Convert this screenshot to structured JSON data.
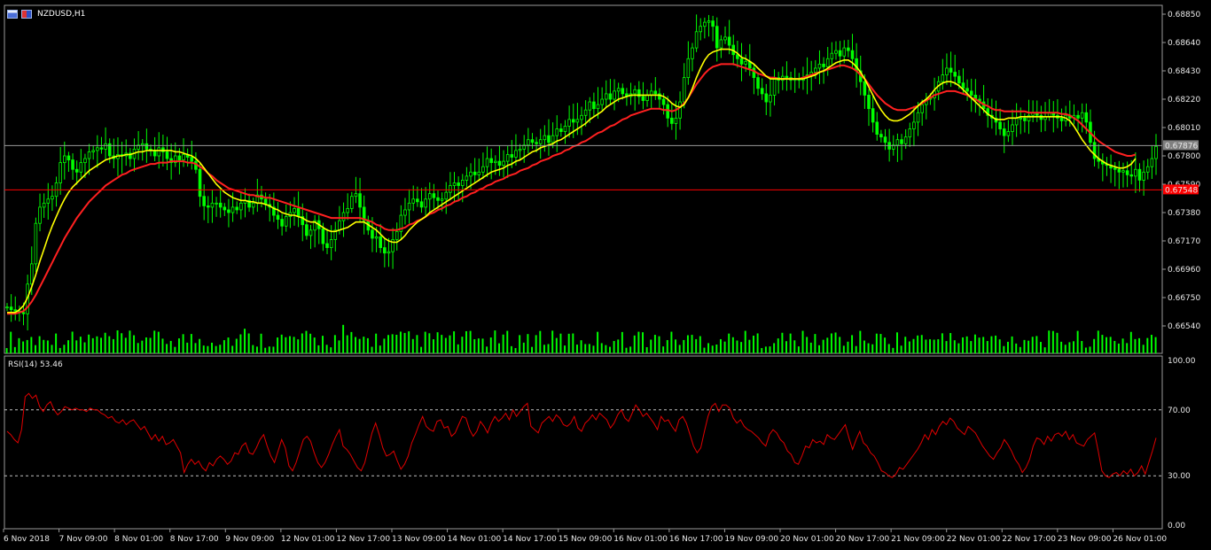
{
  "title": {
    "symbol": "NZDUSD,H1"
  },
  "colors": {
    "background": "#000000",
    "candle": "#00ff00",
    "ma_fast": "#ffff00",
    "ma_slow": "#ff2020",
    "rsi": "#e00000",
    "bid_line": "#9a9a9a",
    "ask_line": "#ff0000",
    "grid_text": "#e8e8e8"
  },
  "price_axis": {
    "ticks": [
      "0.68850",
      "0.68640",
      "0.68430",
      "0.68220",
      "0.68010",
      "0.67800",
      "0.67590",
      "0.67380",
      "0.67170",
      "0.66960",
      "0.66750",
      "0.66540"
    ],
    "current_bid": "0.67876",
    "ask_label": "0.67548"
  },
  "rsi_panel": {
    "label": "RSI(14) 53.46",
    "ticks": [
      "100.00",
      "70.00",
      "30.00",
      "0.00"
    ],
    "levels": [
      70,
      30
    ],
    "values": [
      57,
      55,
      52,
      50,
      58,
      78,
      80,
      77,
      79,
      72,
      69,
      73,
      75,
      70,
      67,
      69,
      72,
      71,
      70,
      71,
      70,
      70,
      69,
      71,
      70,
      70,
      68,
      67,
      65,
      66,
      63,
      62,
      64,
      61,
      63,
      64,
      61,
      58,
      60,
      56,
      52,
      55,
      51,
      54,
      49,
      50,
      52,
      48,
      44,
      32,
      37,
      40,
      37,
      39,
      35,
      33,
      38,
      36,
      40,
      42,
      40,
      37,
      39,
      44,
      43,
      48,
      50,
      44,
      43,
      47,
      52,
      55,
      48,
      42,
      38,
      45,
      52,
      47,
      36,
      33,
      38,
      45,
      52,
      54,
      51,
      44,
      38,
      35,
      38,
      43,
      49,
      54,
      58,
      48,
      46,
      43,
      39,
      35,
      33,
      38,
      47,
      56,
      62,
      55,
      47,
      42,
      43,
      45,
      39,
      34,
      37,
      42,
      50,
      55,
      61,
      66,
      60,
      58,
      57,
      63,
      64,
      59,
      60,
      54,
      56,
      61,
      66,
      65,
      58,
      54,
      57,
      63,
      60,
      56,
      62,
      66,
      63,
      65,
      68,
      64,
      70,
      66,
      69,
      72,
      74,
      60,
      58,
      56,
      62,
      64,
      66,
      63,
      67,
      65,
      61,
      60,
      62,
      66,
      59,
      57,
      62,
      64,
      67,
      64,
      68,
      66,
      64,
      59,
      62,
      67,
      70,
      65,
      63,
      68,
      73,
      70,
      66,
      68,
      65,
      62,
      58,
      66,
      63,
      64,
      60,
      57,
      64,
      66,
      62,
      55,
      48,
      44,
      47,
      57,
      66,
      72,
      74,
      69,
      73,
      73,
      71,
      65,
      62,
      64,
      60,
      58,
      57,
      55,
      53,
      50,
      48,
      55,
      58,
      56,
      52,
      50,
      45,
      43,
      38,
      37,
      42,
      48,
      47,
      52,
      50,
      51,
      49,
      55,
      53,
      52,
      55,
      58,
      61,
      53,
      46,
      52,
      57,
      50,
      48,
      44,
      42,
      38,
      33,
      32,
      30,
      29,
      31,
      35,
      34,
      37,
      40,
      43,
      46,
      50,
      55,
      52,
      58,
      55,
      60,
      63,
      61,
      65,
      63,
      59,
      57,
      55,
      60,
      58,
      56,
      52,
      48,
      45,
      42,
      40,
      44,
      47,
      52,
      49,
      45,
      40,
      37,
      32,
      35,
      40,
      48,
      53,
      52,
      49,
      54,
      51,
      55,
      56,
      54,
      57,
      52,
      55,
      50,
      49,
      48,
      52,
      54,
      56,
      45,
      33,
      30,
      29,
      31,
      32,
      30,
      33,
      31,
      34,
      30,
      32,
      36,
      31,
      38,
      45,
      53
    ],
    "rsi_range": [
      0,
      100
    ]
  },
  "time_axis": {
    "labels": [
      "6 Nov 2018",
      "7 Nov 09:00",
      "8 Nov 01:00",
      "8 Nov 17:00",
      "9 Nov 09:00",
      "12 Nov 01:00",
      "12 Nov 17:00",
      "13 Nov 09:00",
      "14 Nov 01:00",
      "14 Nov 17:00",
      "15 Nov 09:00",
      "16 Nov 01:00",
      "16 Nov 17:00",
      "19 Nov 09:00",
      "20 Nov 01:00",
      "20 Nov 17:00",
      "21 Nov 09:00",
      "22 Nov 01:00",
      "22 Nov 17:00",
      "23 Nov 09:00",
      "26 Nov 01:00"
    ]
  },
  "chart_data": {
    "type": "line",
    "title": "NZDUSD,H1",
    "price_range": [
      0.6642,
      0.6893
    ],
    "series": [
      {
        "name": "",
        "role": "close",
        "values": [
          0.6668,
          0.6666,
          0.6665,
          0.6664,
          0.6663,
          0.6685,
          0.67,
          0.673,
          0.6742,
          0.6745,
          0.6748,
          0.675,
          0.676,
          0.6775,
          0.678,
          0.6777,
          0.677,
          0.6768,
          0.6775,
          0.6778,
          0.6783,
          0.6784,
          0.6786,
          0.6785,
          0.6789,
          0.678,
          0.6778,
          0.6781,
          0.678,
          0.6782,
          0.6778,
          0.6785,
          0.6788,
          0.6789,
          0.6785,
          0.6784,
          0.678,
          0.6786,
          0.6783,
          0.6778,
          0.6775,
          0.678,
          0.6777,
          0.6781,
          0.6779,
          0.6776,
          0.677,
          0.675,
          0.6743,
          0.6742,
          0.6745,
          0.6745,
          0.6742,
          0.674,
          0.6738,
          0.6742,
          0.674,
          0.6745,
          0.6747,
          0.6742,
          0.6745,
          0.6751,
          0.6748,
          0.6744,
          0.6742,
          0.6736,
          0.6733,
          0.6728,
          0.6735,
          0.6738,
          0.6741,
          0.6735,
          0.6729,
          0.6721,
          0.6725,
          0.6732,
          0.6726,
          0.6715,
          0.6712,
          0.6718,
          0.6725,
          0.6732,
          0.6738,
          0.6741,
          0.675,
          0.6752,
          0.6742,
          0.6732,
          0.6725,
          0.6719,
          0.672,
          0.6712,
          0.6708,
          0.6709,
          0.6718,
          0.6724,
          0.6736,
          0.674,
          0.6745,
          0.6748,
          0.6746,
          0.6742,
          0.6748,
          0.6752,
          0.6749,
          0.6747,
          0.6748,
          0.6753,
          0.6758,
          0.676,
          0.6758,
          0.6762,
          0.6765,
          0.6768,
          0.6766,
          0.6768,
          0.6772,
          0.6778,
          0.6775,
          0.6776,
          0.6773,
          0.6776,
          0.6781,
          0.6779,
          0.6784,
          0.6785,
          0.6788,
          0.6792,
          0.679,
          0.6789,
          0.6792,
          0.6795,
          0.679,
          0.6795,
          0.68,
          0.6798,
          0.6802,
          0.6807,
          0.6805,
          0.6807,
          0.681,
          0.6814,
          0.682,
          0.6815,
          0.6818,
          0.6822,
          0.6826,
          0.6822,
          0.6828,
          0.683,
          0.6826,
          0.6824,
          0.6826,
          0.6829,
          0.6824,
          0.6821,
          0.6825,
          0.6828,
          0.6826,
          0.6822,
          0.6818,
          0.6808,
          0.6804,
          0.6808,
          0.682,
          0.6838,
          0.6852,
          0.686,
          0.6872,
          0.6876,
          0.6879,
          0.688,
          0.6876,
          0.686,
          0.6866,
          0.6868,
          0.6862,
          0.6855,
          0.6852,
          0.6848,
          0.685,
          0.6845,
          0.6838,
          0.683,
          0.6826,
          0.682,
          0.6825,
          0.6838,
          0.6836,
          0.6839,
          0.6838,
          0.6836,
          0.6837,
          0.6836,
          0.6838,
          0.684,
          0.6842,
          0.6845,
          0.6848,
          0.6846,
          0.6852,
          0.6856,
          0.6858,
          0.6854,
          0.686,
          0.6858,
          0.6852,
          0.6843,
          0.6835,
          0.6825,
          0.6815,
          0.6805,
          0.6796,
          0.6794,
          0.679,
          0.6785,
          0.6788,
          0.6792,
          0.6789,
          0.6794,
          0.68,
          0.6805,
          0.6812,
          0.6818,
          0.6822,
          0.6823,
          0.6828,
          0.6835,
          0.684,
          0.6845,
          0.6842,
          0.6839,
          0.6834,
          0.683,
          0.6828,
          0.6825,
          0.6822,
          0.682,
          0.6815,
          0.681,
          0.6808,
          0.6805,
          0.68,
          0.6795,
          0.6798,
          0.6803,
          0.6808,
          0.6808,
          0.6806,
          0.681,
          0.6812,
          0.681,
          0.6807,
          0.6809,
          0.6812,
          0.681,
          0.6808,
          0.6806,
          0.681,
          0.6808,
          0.681,
          0.6808,
          0.6812,
          0.6805,
          0.679,
          0.6778,
          0.6776,
          0.6774,
          0.6773,
          0.6771,
          0.677,
          0.6768,
          0.6769,
          0.6766,
          0.6765,
          0.677,
          0.6762,
          0.6768,
          0.6772,
          0.6778,
          0.6787
        ]
      },
      {
        "name": "",
        "role": "ma_fast",
        "values": [
          0.6664,
          0.6664,
          0.6664,
          0.6666,
          0.6669,
          0.6675,
          0.6683,
          0.6692,
          0.6702,
          0.6711,
          0.672,
          0.6728,
          0.6735,
          0.6742,
          0.6748,
          0.6753,
          0.6757,
          0.676,
          0.6763,
          0.6766,
          0.6769,
          0.6771,
          0.6773,
          0.6775,
          0.6777,
          0.6778,
          0.6779,
          0.678,
          0.678,
          0.6781,
          0.6781,
          0.6782,
          0.6783,
          0.6783,
          0.6784,
          0.6784,
          0.6784,
          0.6784,
          0.6784,
          0.6784,
          0.6784,
          0.6783,
          0.6783,
          0.6782,
          0.6781,
          0.678,
          0.6778,
          0.6775,
          0.6771,
          0.6767,
          0.6763,
          0.6759,
          0.6756,
          0.6753,
          0.6751,
          0.6749,
          0.6748,
          0.6747,
          0.6747,
          0.6746,
          0.6746,
          0.6745,
          0.6745,
          0.6744,
          0.6743,
          0.6741,
          0.674,
          0.6738,
          0.6737,
          0.6736,
          0.6736,
          0.6735,
          0.6734,
          0.6732,
          0.6731,
          0.6731,
          0.6729,
          0.6727,
          0.6725,
          0.6724,
          0.6724,
          0.6725,
          0.6726,
          0.6727,
          0.6729,
          0.6731,
          0.6731,
          0.6731,
          0.6729,
          0.6727,
          0.6725,
          0.6722,
          0.6719,
          0.6717,
          0.6716,
          0.6716,
          0.6718,
          0.6721,
          0.6725,
          0.6728,
          0.6731,
          0.6733,
          0.6735,
          0.6738,
          0.674,
          0.6742,
          0.6744,
          0.6746,
          0.6748,
          0.675,
          0.6752,
          0.6754,
          0.6756,
          0.6758,
          0.676,
          0.6762,
          0.6764,
          0.6766,
          0.6768,
          0.6769,
          0.677,
          0.6771,
          0.6773,
          0.6774,
          0.6776,
          0.6777,
          0.6779,
          0.6781,
          0.6783,
          0.6784,
          0.6786,
          0.6787,
          0.6788,
          0.6789,
          0.6791,
          0.6792,
          0.6794,
          0.6796,
          0.6798,
          0.68,
          0.6802,
          0.6804,
          0.6807,
          0.6809,
          0.6811,
          0.6813,
          0.6816,
          0.6818,
          0.682,
          0.6822,
          0.6823,
          0.6824,
          0.6825,
          0.6825,
          0.6825,
          0.6825,
          0.6825,
          0.6825,
          0.6825,
          0.6825,
          0.6824,
          0.6822,
          0.6819,
          0.6817,
          0.6816,
          0.6818,
          0.6823,
          0.683,
          0.6838,
          0.6845,
          0.6851,
          0.6855,
          0.6857,
          0.6858,
          0.6859,
          0.6859,
          0.6859,
          0.6858,
          0.6856,
          0.6853,
          0.6852,
          0.685,
          0.6848,
          0.6845,
          0.6842,
          0.6839,
          0.6837,
          0.6837,
          0.6837,
          0.6837,
          0.6837,
          0.6837,
          0.6837,
          0.6837,
          0.6837,
          0.6838,
          0.6839,
          0.684,
          0.6842,
          0.6843,
          0.6845,
          0.6847,
          0.6849,
          0.685,
          0.6851,
          0.6851,
          0.6849,
          0.6846,
          0.6842,
          0.6837,
          0.6831,
          0.6825,
          0.6819,
          0.6814,
          0.681,
          0.6807,
          0.6806,
          0.6806,
          0.6807,
          0.6809,
          0.6811,
          0.6814,
          0.6817,
          0.682,
          0.6822,
          0.6825,
          0.6829,
          0.6832,
          0.6834,
          0.6835,
          0.6835,
          0.6834,
          0.6832,
          0.6829,
          0.6826,
          0.6823,
          0.682,
          0.6817,
          0.6814,
          0.6811,
          0.6809,
          0.6807,
          0.6807,
          0.6807,
          0.6808,
          0.6808,
          0.6808,
          0.6809,
          0.6809,
          0.6809,
          0.6809,
          0.6809,
          0.6809,
          0.6809,
          0.6809,
          0.6809,
          0.6809,
          0.6809,
          0.6808,
          0.6806,
          0.6802,
          0.6797,
          0.6792,
          0.6788,
          0.6784,
          0.6781,
          0.6778,
          0.6776,
          0.6774,
          0.6773,
          0.6772,
          0.6771,
          0.6771,
          0.6772,
          0.6774,
          0.6778
        ]
      },
      {
        "name": "",
        "role": "ma_slow",
        "values": [
          0.6663,
          0.6663,
          0.6663,
          0.6664,
          0.6665,
          0.6668,
          0.6672,
          0.6677,
          0.6683,
          0.6689,
          0.6695,
          0.6701,
          0.6707,
          0.6713,
          0.6719,
          0.6724,
          0.6729,
          0.6734,
          0.6738,
          0.6742,
          0.6746,
          0.6749,
          0.6752,
          0.6755,
          0.6758,
          0.676,
          0.6762,
          0.6764,
          0.6766,
          0.6767,
          0.6769,
          0.677,
          0.6771,
          0.6772,
          0.6773,
          0.6774,
          0.6774,
          0.6775,
          0.6775,
          0.6775,
          0.6776,
          0.6776,
          0.6776,
          0.6776,
          0.6775,
          0.6775,
          0.6774,
          0.6772,
          0.677,
          0.6767,
          0.6765,
          0.6762,
          0.676,
          0.6758,
          0.6756,
          0.6755,
          0.6754,
          0.6753,
          0.6752,
          0.6751,
          0.6751,
          0.675,
          0.675,
          0.6749,
          0.6749,
          0.6748,
          0.6747,
          0.6746,
          0.6745,
          0.6744,
          0.6743,
          0.6742,
          0.6741,
          0.674,
          0.6739,
          0.6738,
          0.6737,
          0.6736,
          0.6735,
          0.6734,
          0.6734,
          0.6734,
          0.6734,
          0.6734,
          0.6734,
          0.6734,
          0.6734,
          0.6733,
          0.6732,
          0.6731,
          0.6729,
          0.6728,
          0.6726,
          0.6725,
          0.6725,
          0.6725,
          0.6726,
          0.6727,
          0.6729,
          0.673,
          0.6732,
          0.6733,
          0.6735,
          0.6737,
          0.6738,
          0.674,
          0.6741,
          0.6743,
          0.6744,
          0.6746,
          0.6747,
          0.6749,
          0.675,
          0.6752,
          0.6753,
          0.6755,
          0.6756,
          0.6758,
          0.6759,
          0.6761,
          0.6762,
          0.6763,
          0.6765,
          0.6766,
          0.6767,
          0.6769,
          0.677,
          0.6771,
          0.6773,
          0.6774,
          0.6776,
          0.6777,
          0.6778,
          0.678,
          0.6781,
          0.6782,
          0.6784,
          0.6785,
          0.6787,
          0.6788,
          0.679,
          0.6791,
          0.6793,
          0.6795,
          0.6797,
          0.6798,
          0.68,
          0.6802,
          0.6803,
          0.6805,
          0.6807,
          0.6808,
          0.681,
          0.6811,
          0.6812,
          0.6813,
          0.6814,
          0.6815,
          0.6815,
          0.6815,
          0.6814,
          0.6814,
          0.6813,
          0.6814,
          0.6816,
          0.6819,
          0.6823,
          0.6828,
          0.6833,
          0.6837,
          0.6841,
          0.6844,
          0.6846,
          0.6847,
          0.6848,
          0.6848,
          0.6848,
          0.6848,
          0.6847,
          0.6846,
          0.6845,
          0.6844,
          0.6843,
          0.6841,
          0.684,
          0.6839,
          0.6838,
          0.6838,
          0.6837,
          0.6837,
          0.6837,
          0.6837,
          0.6837,
          0.6837,
          0.6838,
          0.6839,
          0.684,
          0.6841,
          0.6842,
          0.6843,
          0.6844,
          0.6845,
          0.6846,
          0.6847,
          0.6847,
          0.6846,
          0.6845,
          0.6843,
          0.684,
          0.6837,
          0.6833,
          0.6829,
          0.6825,
          0.6822,
          0.6819,
          0.6817,
          0.6815,
          0.6814,
          0.6814,
          0.6814,
          0.6815,
          0.6816,
          0.6817,
          0.6819,
          0.6821,
          0.6823,
          0.6825,
          0.6826,
          0.6827,
          0.6828,
          0.6828,
          0.6828,
          0.6827,
          0.6826,
          0.6825,
          0.6823,
          0.6822,
          0.682,
          0.6818,
          0.6817,
          0.6815,
          0.6814,
          0.6814,
          0.6813,
          0.6813,
          0.6813,
          0.6813,
          0.6813,
          0.6813,
          0.6812,
          0.6812,
          0.6812,
          0.6812,
          0.6812,
          0.6812,
          0.6812,
          0.6812,
          0.6811,
          0.6811,
          0.681,
          0.6808,
          0.6806,
          0.6803,
          0.68,
          0.6797,
          0.6794,
          0.6791,
          0.6789,
          0.6787,
          0.6785,
          0.6783,
          0.6782,
          0.6781,
          0.678,
          0.678,
          0.6781
        ]
      }
    ]
  }
}
